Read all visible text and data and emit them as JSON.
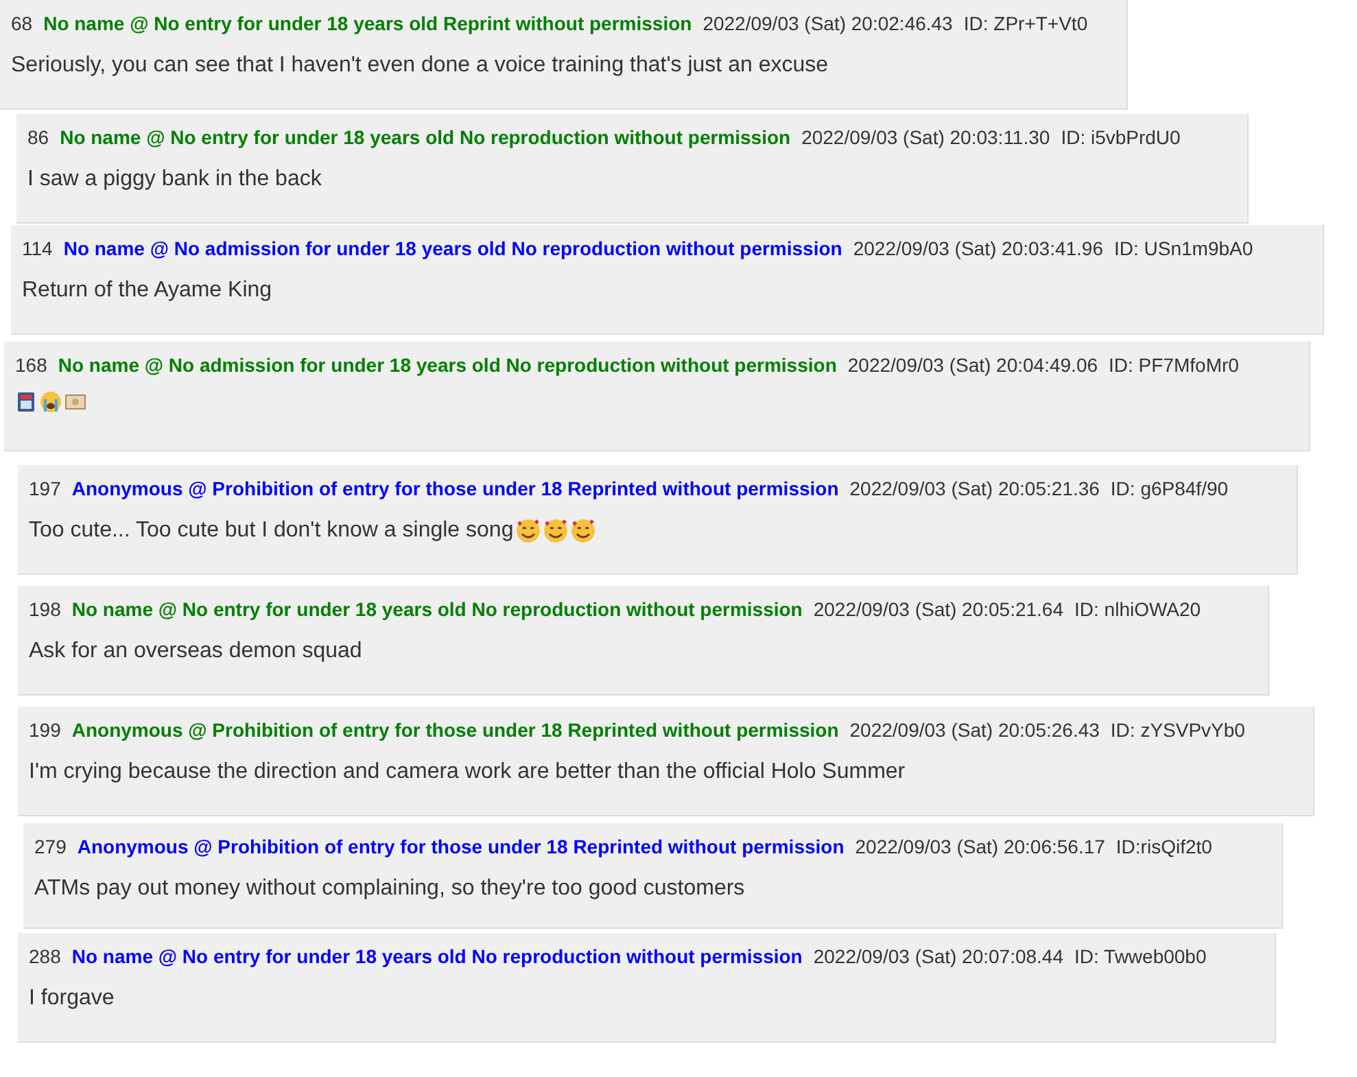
{
  "posts": [
    {
      "number": "68",
      "name": "No name @ No entry for under 18 years old Reprint without permission",
      "color": "#008000",
      "date": "2022/09/03 (Sat) 20:02:46.43",
      "id": "ID: ZPr+T+Vt0",
      "body": "Seriously, you can see that I haven't even done a voice training that's just an excuse"
    },
    {
      "number": "86",
      "name": "No name @ No entry for under 18 years old No reproduction without permission",
      "color": "#008000",
      "date": "2022/09/03 (Sat) 20:03:11.30",
      "id": "ID: i5vbPrdU0",
      "body": "I saw a piggy bank in the back"
    },
    {
      "number": "114",
      "name": "No name @ No admission for under 18 years old No reproduction without permission",
      "color": "#0000ff",
      "date": "2022/09/03 (Sat) 20:03:41.96",
      "id": "ID: USn1m9bA0",
      "body": "Return of the Ayame King"
    },
    {
      "number": "168",
      "name": "No name @ No admission for under 18 years old No reproduction without permission",
      "color": "#008000",
      "date": "2022/09/03 (Sat) 20:04:49.06",
      "id": "ID: PF7MfoMr0",
      "emojis": [
        {
          "kind": "atm"
        },
        {
          "kind": "crying"
        },
        {
          "kind": "money"
        }
      ]
    },
    {
      "number": "197",
      "name": "Anonymous @ Prohibition of entry for those under 18 Reprinted without permission",
      "color": "#0000ff",
      "date": "2022/09/03 (Sat) 20:05:21.36",
      "id": "ID: g6P84f/90",
      "body": "Too cute... Too cute but I don't know a single song",
      "emojis": [
        {
          "kind": "hearts"
        },
        {
          "kind": "hearts"
        },
        {
          "kind": "hearts"
        }
      ]
    },
    {
      "number": "198",
      "name": "No name @ No entry for under 18 years old No reproduction without permission",
      "color": "#008000",
      "date": "2022/09/03 (Sat) 20:05:21.64",
      "id": "ID: nlhiOWA20",
      "body": "Ask for an overseas demon squad"
    },
    {
      "number": "199",
      "name": "Anonymous @ Prohibition of entry for those under 18 Reprinted without permission",
      "color": "#008000",
      "date": "2022/09/03 (Sat) 20:05:26.43",
      "id": "ID: zYSVPvYb0",
      "body": "I'm crying because the direction and camera work are better than the official Holo Summer"
    },
    {
      "number": "279",
      "name": "Anonymous @ Prohibition of entry for those under 18 Reprinted without permission",
      "color": "#0000ff",
      "date": "2022/09/03 (Sat) 20:06:56.17",
      "id": "ID:risQif2t0",
      "body": "ATMs pay out money without complaining, so they're too good customers"
    },
    {
      "number": "288",
      "name": "No name @ No entry for under 18 years old No reproduction without permission",
      "color": "#0000ff",
      "date": "2022/09/03 (Sat) 20:07:08.44",
      "id": "ID: Twweb00b0",
      "body": "I forgave"
    }
  ]
}
